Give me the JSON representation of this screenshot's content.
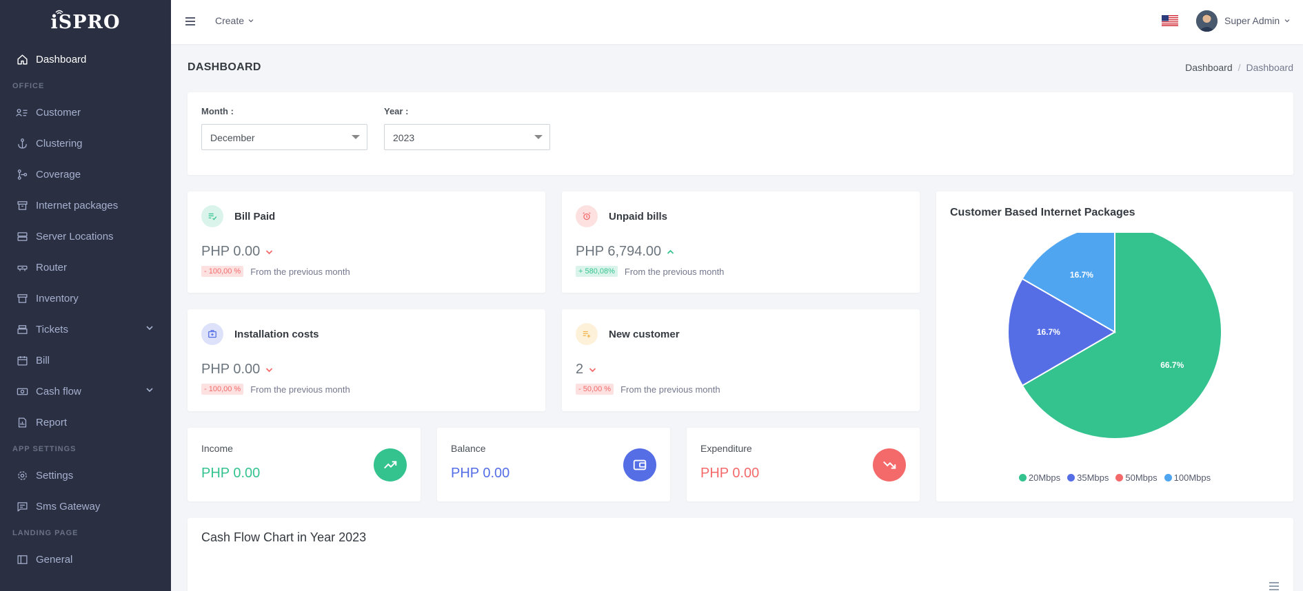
{
  "app": {
    "logo": "iSPRO"
  },
  "sidebar": {
    "items": [
      {
        "label": "Dashboard"
      },
      {
        "section": "OFFICE"
      },
      {
        "label": "Customer"
      },
      {
        "label": "Clustering"
      },
      {
        "label": "Coverage"
      },
      {
        "label": "Internet packages"
      },
      {
        "label": "Server Locations"
      },
      {
        "label": "Router"
      },
      {
        "label": "Inventory"
      },
      {
        "label": "Tickets"
      },
      {
        "label": "Bill"
      },
      {
        "label": "Cash flow"
      },
      {
        "label": "Report"
      },
      {
        "section": "APP SETTINGS"
      },
      {
        "label": "Settings"
      },
      {
        "label": "Sms Gateway"
      },
      {
        "section": "LANDING PAGE"
      },
      {
        "label": "General"
      }
    ]
  },
  "topbar": {
    "create_label": "Create",
    "user_name": "Super Admin"
  },
  "page": {
    "title": "DASHBOARD",
    "breadcrumb": [
      "Dashboard",
      "Dashboard"
    ]
  },
  "filters": {
    "month_label": "Month :",
    "month_value": "December",
    "year_label": "Year :",
    "year_value": "2023"
  },
  "stats": {
    "bill_paid": {
      "title": "Bill Paid",
      "value": "PHP 0.00",
      "change": "- 100,00 %",
      "foot": "From the previous month"
    },
    "unpaid": {
      "title": "Unpaid bills",
      "value": "PHP 6,794.00",
      "change": "+ 580,08%",
      "foot": "From the previous month"
    },
    "installation": {
      "title": "Installation costs",
      "value": "PHP 0.00",
      "change": "- 100,00 %",
      "foot": "From the previous month"
    },
    "new_customer": {
      "title": "New customer",
      "value": "2",
      "change": "- 50,00 %",
      "foot": "From the previous month"
    }
  },
  "mini": {
    "income": {
      "title": "Income",
      "value": "PHP 0.00"
    },
    "balance": {
      "title": "Balance",
      "value": "PHP 0.00"
    },
    "expenditure": {
      "title": "Expenditure",
      "value": "PHP 0.00"
    }
  },
  "colors": {
    "green": "#34c38f",
    "blue": "#556ee6",
    "red": "#f46a6a",
    "lightblue": "#50a5f1"
  },
  "chart_data": {
    "type": "pie",
    "title": "Customer Based Internet Packages",
    "categories": [
      "20Mbps",
      "35Mbps",
      "50Mbps",
      "100Mbps"
    ],
    "values": [
      66.7,
      16.7,
      0,
      16.7
    ],
    "labels": [
      "66.7%",
      "16.7%",
      "",
      "16.7%"
    ],
    "colors": [
      "#34c38f",
      "#556ee6",
      "#f46a6a",
      "#50a5f1"
    ],
    "legend": "bottom"
  },
  "cashflow": {
    "title": "Cash Flow Chart in Year 2023"
  }
}
